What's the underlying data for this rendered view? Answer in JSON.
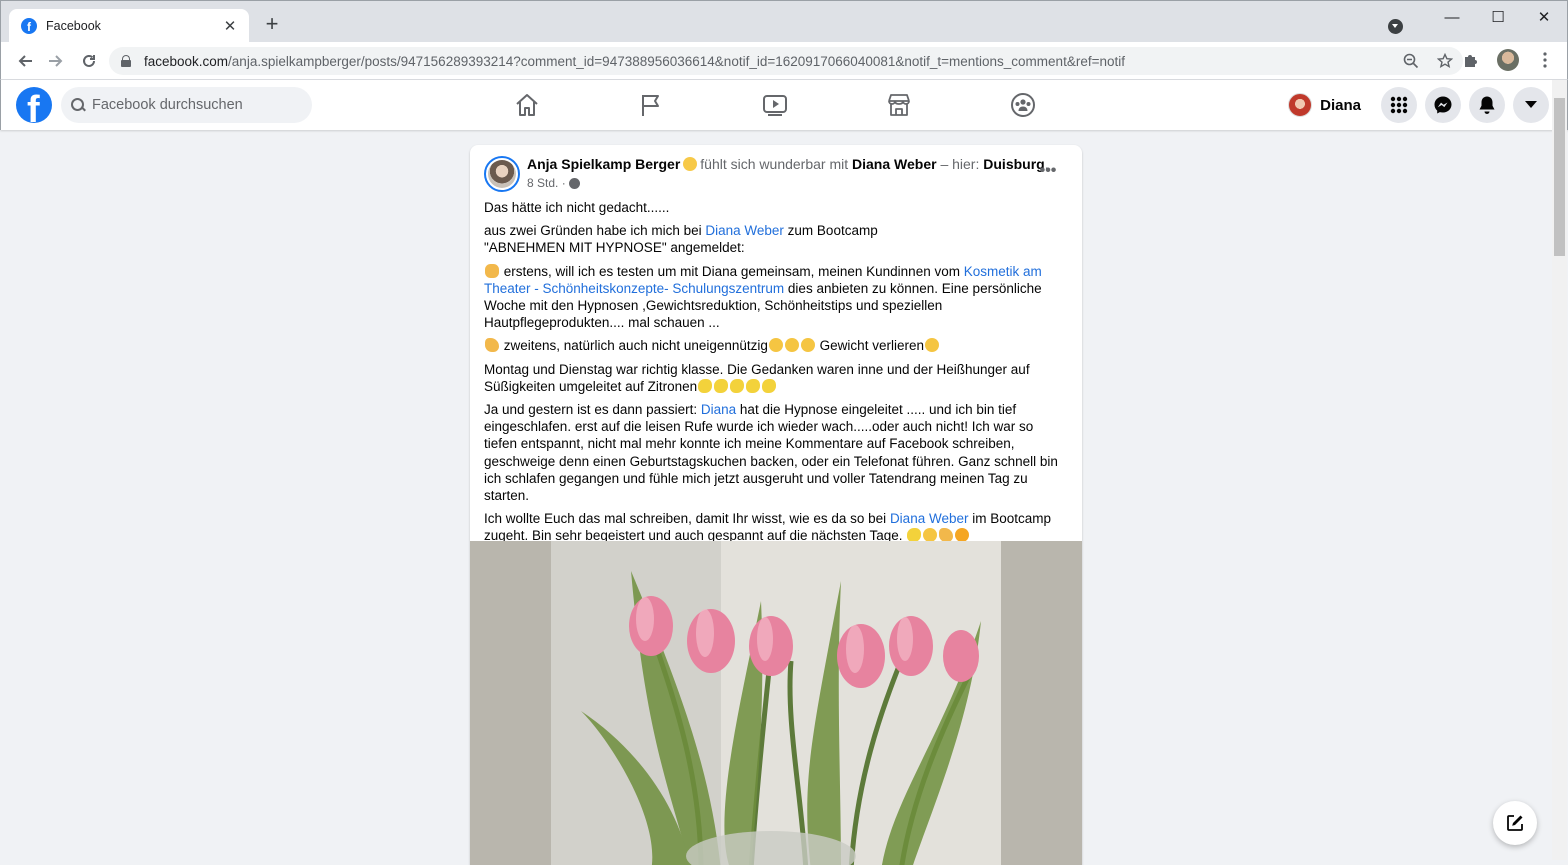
{
  "browser": {
    "tab_title": "Facebook",
    "tab_close": "✕",
    "new_tab": "+",
    "url_host": "facebook.com",
    "url_path": "/anja.spielkampberger/posts/947156289393214?comment_id=947388956036614&notif_id=1620917066040081&notif_t=mentions_comment&ref=notif",
    "window_controls": {
      "minimize": "—",
      "maximize": "☐",
      "close": "✕"
    }
  },
  "facebook": {
    "logo_letter": "f",
    "search_placeholder": "Facebook durchsuchen",
    "nav_icons": [
      "home-icon",
      "pages-flag-icon",
      "watch-video-icon",
      "marketplace-icon",
      "groups-icon"
    ],
    "profile_name": "Diana",
    "accent_color": "#1877f2"
  },
  "post": {
    "author": "Anja Spielkamp Berger",
    "feeling_text": "fühlt sich wunderbar mit",
    "tagged": "Diana Weber",
    "location_prefix": "– hier:",
    "location": "Duisburg",
    "location_suffix": ".",
    "time": "8 Std.",
    "time_sep": "·",
    "more": "•••",
    "p1": "Das hätte ich nicht gedacht......",
    "p2_a": "aus zwei Gründen habe ich mich bei ",
    "p2_link": "Diana Weber",
    "p2_b": " zum Bootcamp",
    "p2_c": "\"ABNEHMEN MIT HYPNOSE\" angemeldet:",
    "p3_a": " erstens, will ich es testen um mit Diana gemeinsam, meinen Kundinnen vom ",
    "p3_link": "Kosmetik am Theater - Schönheitskonzepte-  Schulungszentrum",
    "p3_b": " dies anbieten zu können. Eine persönliche Woche mit  den Hypnosen ,Gewichtsreduktion, Schönheitstips und speziellen Hautpflegeprodukten.... mal schauen ...",
    "p4_a": " zweitens, natürlich auch nicht uneigennützig",
    "p4_b": " Gewicht verlieren",
    "p5": "Montag und Dienstag war richtig klasse. Die Gedanken waren inne und der Heißhunger auf Süßigkeiten umgeleitet auf Zitronen",
    "p6_a": "Ja und gestern ist es dann passiert: ",
    "p6_link": "Diana",
    "p6_b": " hat die Hypnose eingeleitet ..... und ich bin tief eingeschlafen. erst auf die leisen Rufe wurde ich wieder wach.....oder auch nicht! Ich war so tiefen entspannt, nicht mal mehr konnte ich meine Kommentare auf Facebook schreiben, geschweige denn einen Geburtstagskuchen backen, oder ein Telefonat führen. Ganz schnell bin ich schlafen gegangen und fühle mich jetzt ausgeruht und voller Tatendrang meinen Tag zu starten.",
    "p7_a": "Ich wollte Euch das mal schreiben, damit Ihr wisst, wie es da so bei ",
    "p7_link": "Diana Weber",
    "p7_b": " im Bootcamp zugeht. Bin sehr begeistert und auch gespannt auf die nächsten Tage. ",
    "link_color": "#216fdb"
  }
}
